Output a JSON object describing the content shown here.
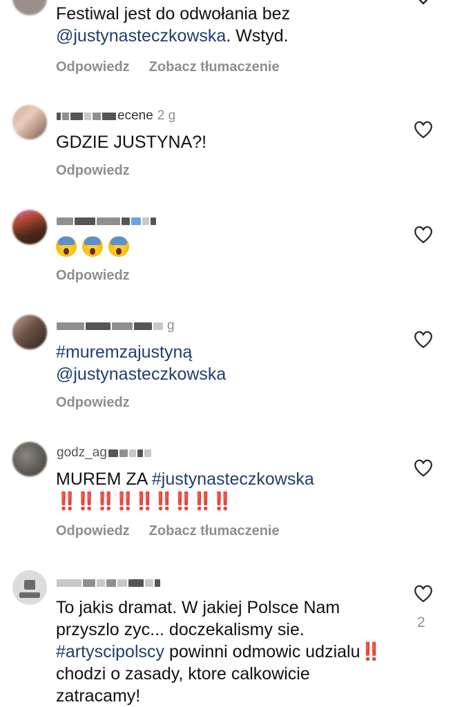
{
  "comments": [
    {
      "text_parts": [
        "Festiwal jest do odwołania bez",
        "@justynasteczkowska",
        ". Wstyd."
      ],
      "reply_label": "Odpowiedz",
      "translate_label": "Zobacz tłumaczenie"
    },
    {
      "username_visible": "ecene",
      "time": "2 g",
      "text": "GDZIE JUSTYNA?!",
      "reply_label": "Odpowiedz"
    },
    {
      "emoji": [
        "face-screaming-in-fear",
        "face-screaming-in-fear",
        "face-screaming-in-fear"
      ],
      "reply_label": "Odpowiedz"
    },
    {
      "time": "g",
      "text_parts": [
        "#muremzajustyną",
        "@justynasteczkowska"
      ],
      "reply_label": "Odpowiedz"
    },
    {
      "username_visible": "godz_ag",
      "text_parts": [
        "MUREM ZA ",
        "#justynasteczkowska"
      ],
      "double_exclamation": "‼️‼️‼️‼️‼️‼️‼️‼️‼️",
      "reply_label": "Odpowiedz",
      "translate_label": "Zobacz tłumaczenie"
    },
    {
      "text_parts": [
        "To jakis dramat. W jakiej Polsce Nam przyszlo zyc... doczekalismy sie.",
        "#artyscipolscy",
        " powinni odmowic udzialu",
        "‼️",
        " chodzi o zasady, ktore calkowicie zatracamy!"
      ],
      "likes": "2"
    }
  ],
  "colors": {
    "text": "#111111",
    "secondary": "#8e8e8e",
    "link": "#1f3e6f",
    "alert": "#d7262b"
  },
  "icons": [
    "heart-outline-icon",
    "chevron-down-icon"
  ]
}
